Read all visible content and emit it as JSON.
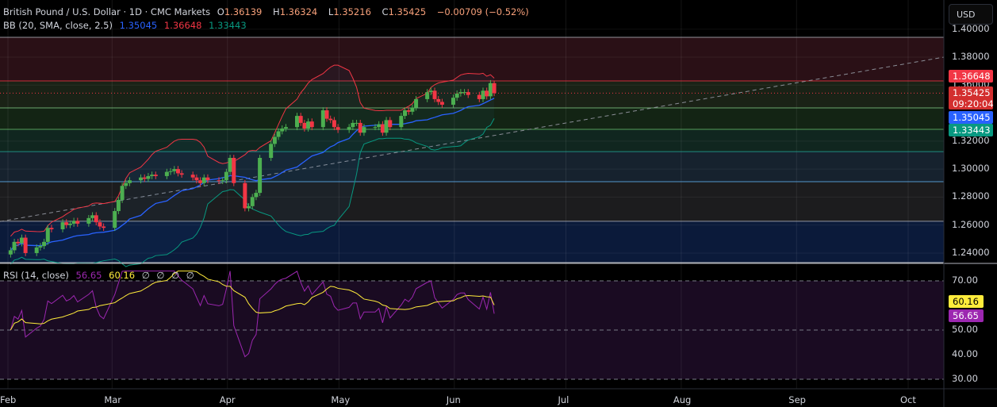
{
  "header": {
    "symbol": "British Pound / U.S. Dollar · 1D · CMC Markets",
    "open_label": "O",
    "open": "1.36139",
    "high_label": "H",
    "high": "1.36324",
    "low_label": "L",
    "low": "1.35216",
    "close_label": "C",
    "close": "1.35425",
    "change": "−0.00709 (−0.52%)"
  },
  "bb_legend": {
    "label": "BB (20, SMA, close, 2.5)",
    "basis": "1.35045",
    "upper": "1.36648",
    "lower": "1.33443"
  },
  "rsi_legend": {
    "label": "RSI (14, close)",
    "rsi": "56.65",
    "ma": "60.16",
    "placeholders": [
      "∅",
      "∅",
      "∅",
      "∅"
    ]
  },
  "currency_button": "USD",
  "badges": {
    "upper": "1.36648",
    "price": "1.35425",
    "countdown": "09:20:04",
    "basis": "1.35045",
    "lower": "1.33443",
    "rsi_ma": "60.16",
    "rsi": "56.65"
  },
  "colors": {
    "up": "#26a69a",
    "up_candle": "#4caf50",
    "down": "#f23645",
    "bb_basis": "#2962ff",
    "bb_upper": "#f23645",
    "bb_lower": "#089981",
    "rsi": "#9c27b0",
    "rsi_ma": "#ffeb3b"
  },
  "chart_data": [
    {
      "type": "candlestick",
      "title": "British Pound / U.S. Dollar · 1D · CMC Markets",
      "start_date": "2025-02-03",
      "interval": "1D (Mon–Fri)",
      "close": [
        1.242,
        1.248,
        1.247,
        1.251,
        1.24,
        1.244,
        1.245,
        1.248,
        1.258,
        1.257,
        1.262,
        1.26,
        1.261,
        1.263,
        1.261,
        1.265,
        1.267,
        1.262,
        1.259,
        1.258,
        1.27,
        1.278,
        1.288,
        1.29,
        1.292,
        1.294,
        1.293,
        1.295,
        1.296,
        1.295,
        1.298,
        1.2985,
        1.3,
        1.297,
        1.296,
        1.294,
        1.292,
        1.29,
        1.294,
        1.292,
        1.2915,
        1.292,
        1.298,
        1.308,
        1.29,
        1.272,
        1.2735,
        1.28,
        1.283,
        1.308,
        1.318,
        1.323,
        1.327,
        1.329,
        1.33,
        1.338,
        1.333,
        1.329,
        1.334,
        1.33,
        1.342,
        1.336,
        1.335,
        1.33,
        1.328,
        1.33,
        1.333,
        1.333,
        1.326,
        1.33,
        1.33,
        1.332,
        1.326,
        1.335,
        1.33,
        1.338,
        1.342,
        1.341,
        1.344,
        1.35,
        1.355,
        1.356,
        1.35,
        1.348,
        1.346,
        1.351,
        1.354,
        1.355,
        1.355,
        1.353,
        1.35,
        1.356,
        1.352,
        1.3614,
        1.35425
      ],
      "last_bar": {
        "open": 1.36139,
        "high": 1.36324,
        "low": 1.35216,
        "close": 1.35425
      },
      "bollinger": {
        "length": 20,
        "ma": "SMA",
        "source": "close",
        "mult": 2.5,
        "basis": 1.35045,
        "upper": 1.36648,
        "lower": 1.33443
      },
      "levels": [
        1.3942,
        1.363,
        1.3437,
        1.3284,
        1.3125,
        1.291,
        1.2627,
        1.2332
      ],
      "trendline": {
        "from": [
          "2025-02-01",
          1.2625
        ],
        "to": [
          "2025-10-09",
          1.38
        ]
      },
      "y_ticks": [
        "1.40000",
        "1.38000",
        "1.36000",
        "1.32000",
        "1.30000",
        "1.28000",
        "1.26000",
        "1.24000"
      ],
      "y_tick_values": [
        1.4,
        1.38,
        1.36,
        1.32,
        1.3,
        1.28,
        1.26,
        1.24
      ],
      "ylim": [
        1.2265,
        1.3985
      ],
      "x_ticks": [
        "Feb",
        "Mar",
        "Apr",
        "May",
        "Jun",
        "Jul",
        "Aug",
        "Sep",
        "Oct"
      ],
      "x_tick_days": [
        0,
        28,
        59,
        89,
        120,
        150,
        181,
        212,
        242
      ]
    },
    {
      "type": "line",
      "title": "RSI (14, close)",
      "series": [
        {
          "name": "RSI",
          "last": 56.65
        },
        {
          "name": "RSI-based MA",
          "last": 60.16
        }
      ],
      "bands": [
        70,
        50,
        30
      ],
      "y_ticks": [
        "70.00",
        "50.00",
        "40.00",
        "30.00"
      ],
      "y_tick_values": [
        70,
        50,
        40,
        30
      ],
      "ylim": [
        26,
        75
      ]
    }
  ]
}
